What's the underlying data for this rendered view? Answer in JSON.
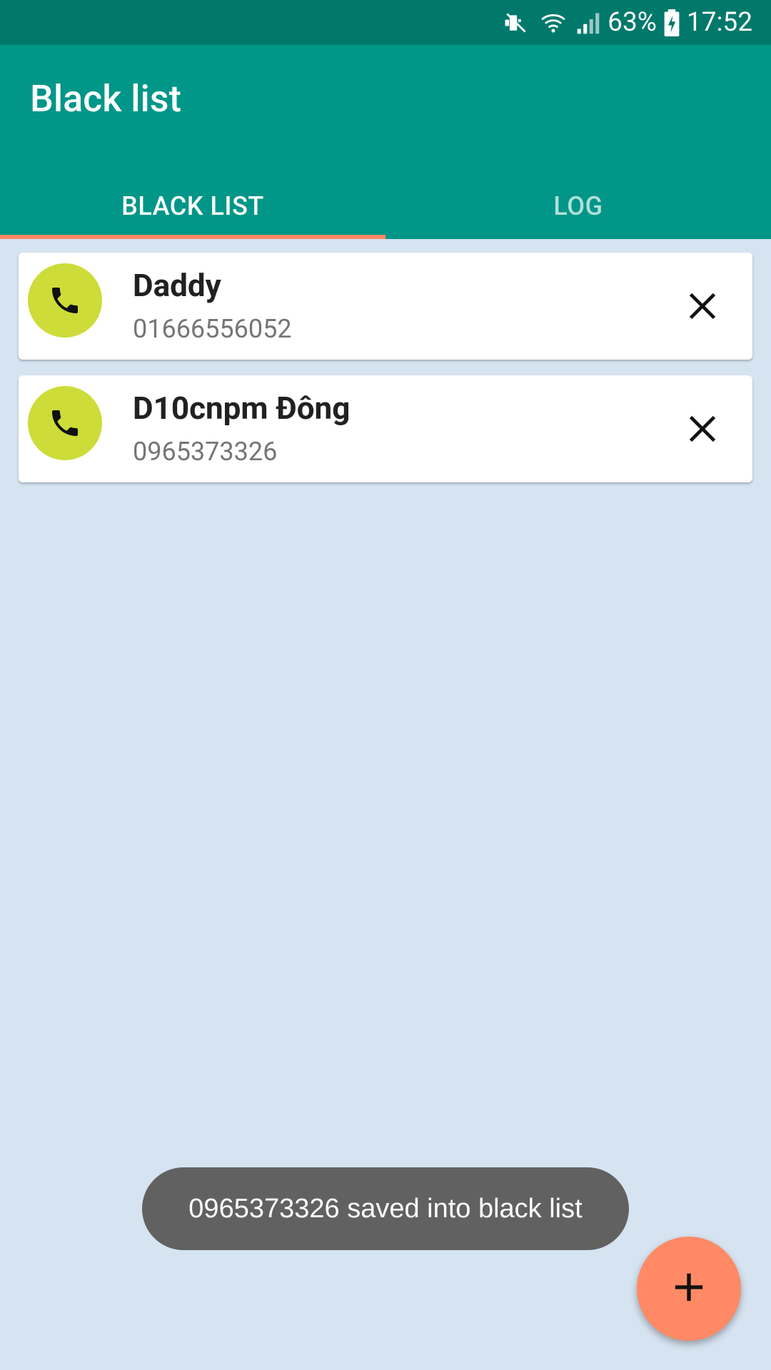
{
  "status_bar": {
    "battery": "63%",
    "time": "17:52"
  },
  "app_bar": {
    "title": "Black list"
  },
  "tabs": [
    {
      "label": "BLACK LIST",
      "active": true
    },
    {
      "label": "LOG",
      "active": false
    }
  ],
  "blacklist": [
    {
      "name": "Daddy",
      "number": "01666556052"
    },
    {
      "name": "D10cnpm Đông",
      "number": "0965373326"
    }
  ],
  "toast": {
    "message": "0965373326 saved into black list"
  },
  "fab": {
    "icon": "plus-icon"
  },
  "colors": {
    "status_bar": "#00796b",
    "primary": "#009688",
    "accent": "#ff8a65",
    "avatar": "#cddc39",
    "background": "#d6e3f1",
    "toast": "#616161"
  }
}
